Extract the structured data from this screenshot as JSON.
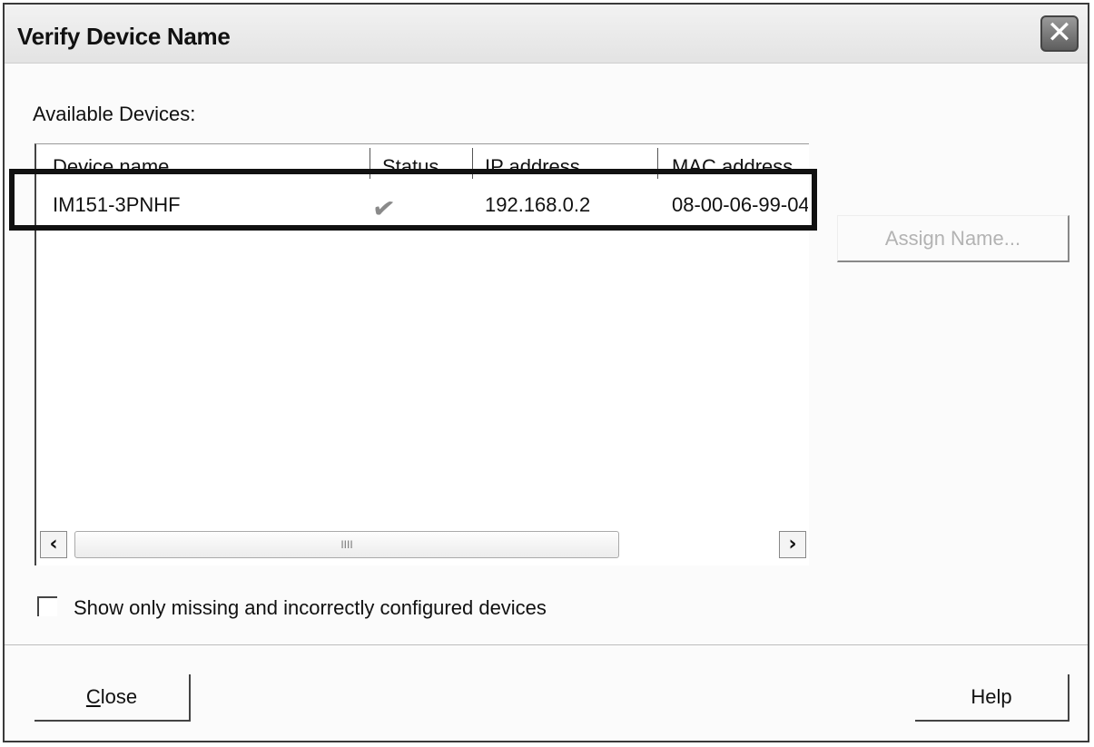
{
  "dialog": {
    "title": "Verify Device Name",
    "close_glyph": "✕"
  },
  "available_label": "Available Devices:",
  "table": {
    "columns": [
      "Device name",
      "Status",
      "IP address",
      "MAC address"
    ],
    "rows": [
      {
        "device_name": "IM151-3PNHF",
        "status_icon": "check-icon",
        "status_glyph": "✔",
        "ip_address": "192.168.0.2",
        "mac_address": "08-00-06-99-04"
      }
    ]
  },
  "scrollbar": {
    "left_arrow": "‹",
    "right_arrow": "›",
    "thumb_grip": "IIII"
  },
  "assign_button_label": "Assign Name...",
  "filter_checkbox": {
    "label": "Show only missing and incorrectly configured devices",
    "checked": false
  },
  "footer": {
    "close_label": "Close",
    "help_label": "Help"
  }
}
